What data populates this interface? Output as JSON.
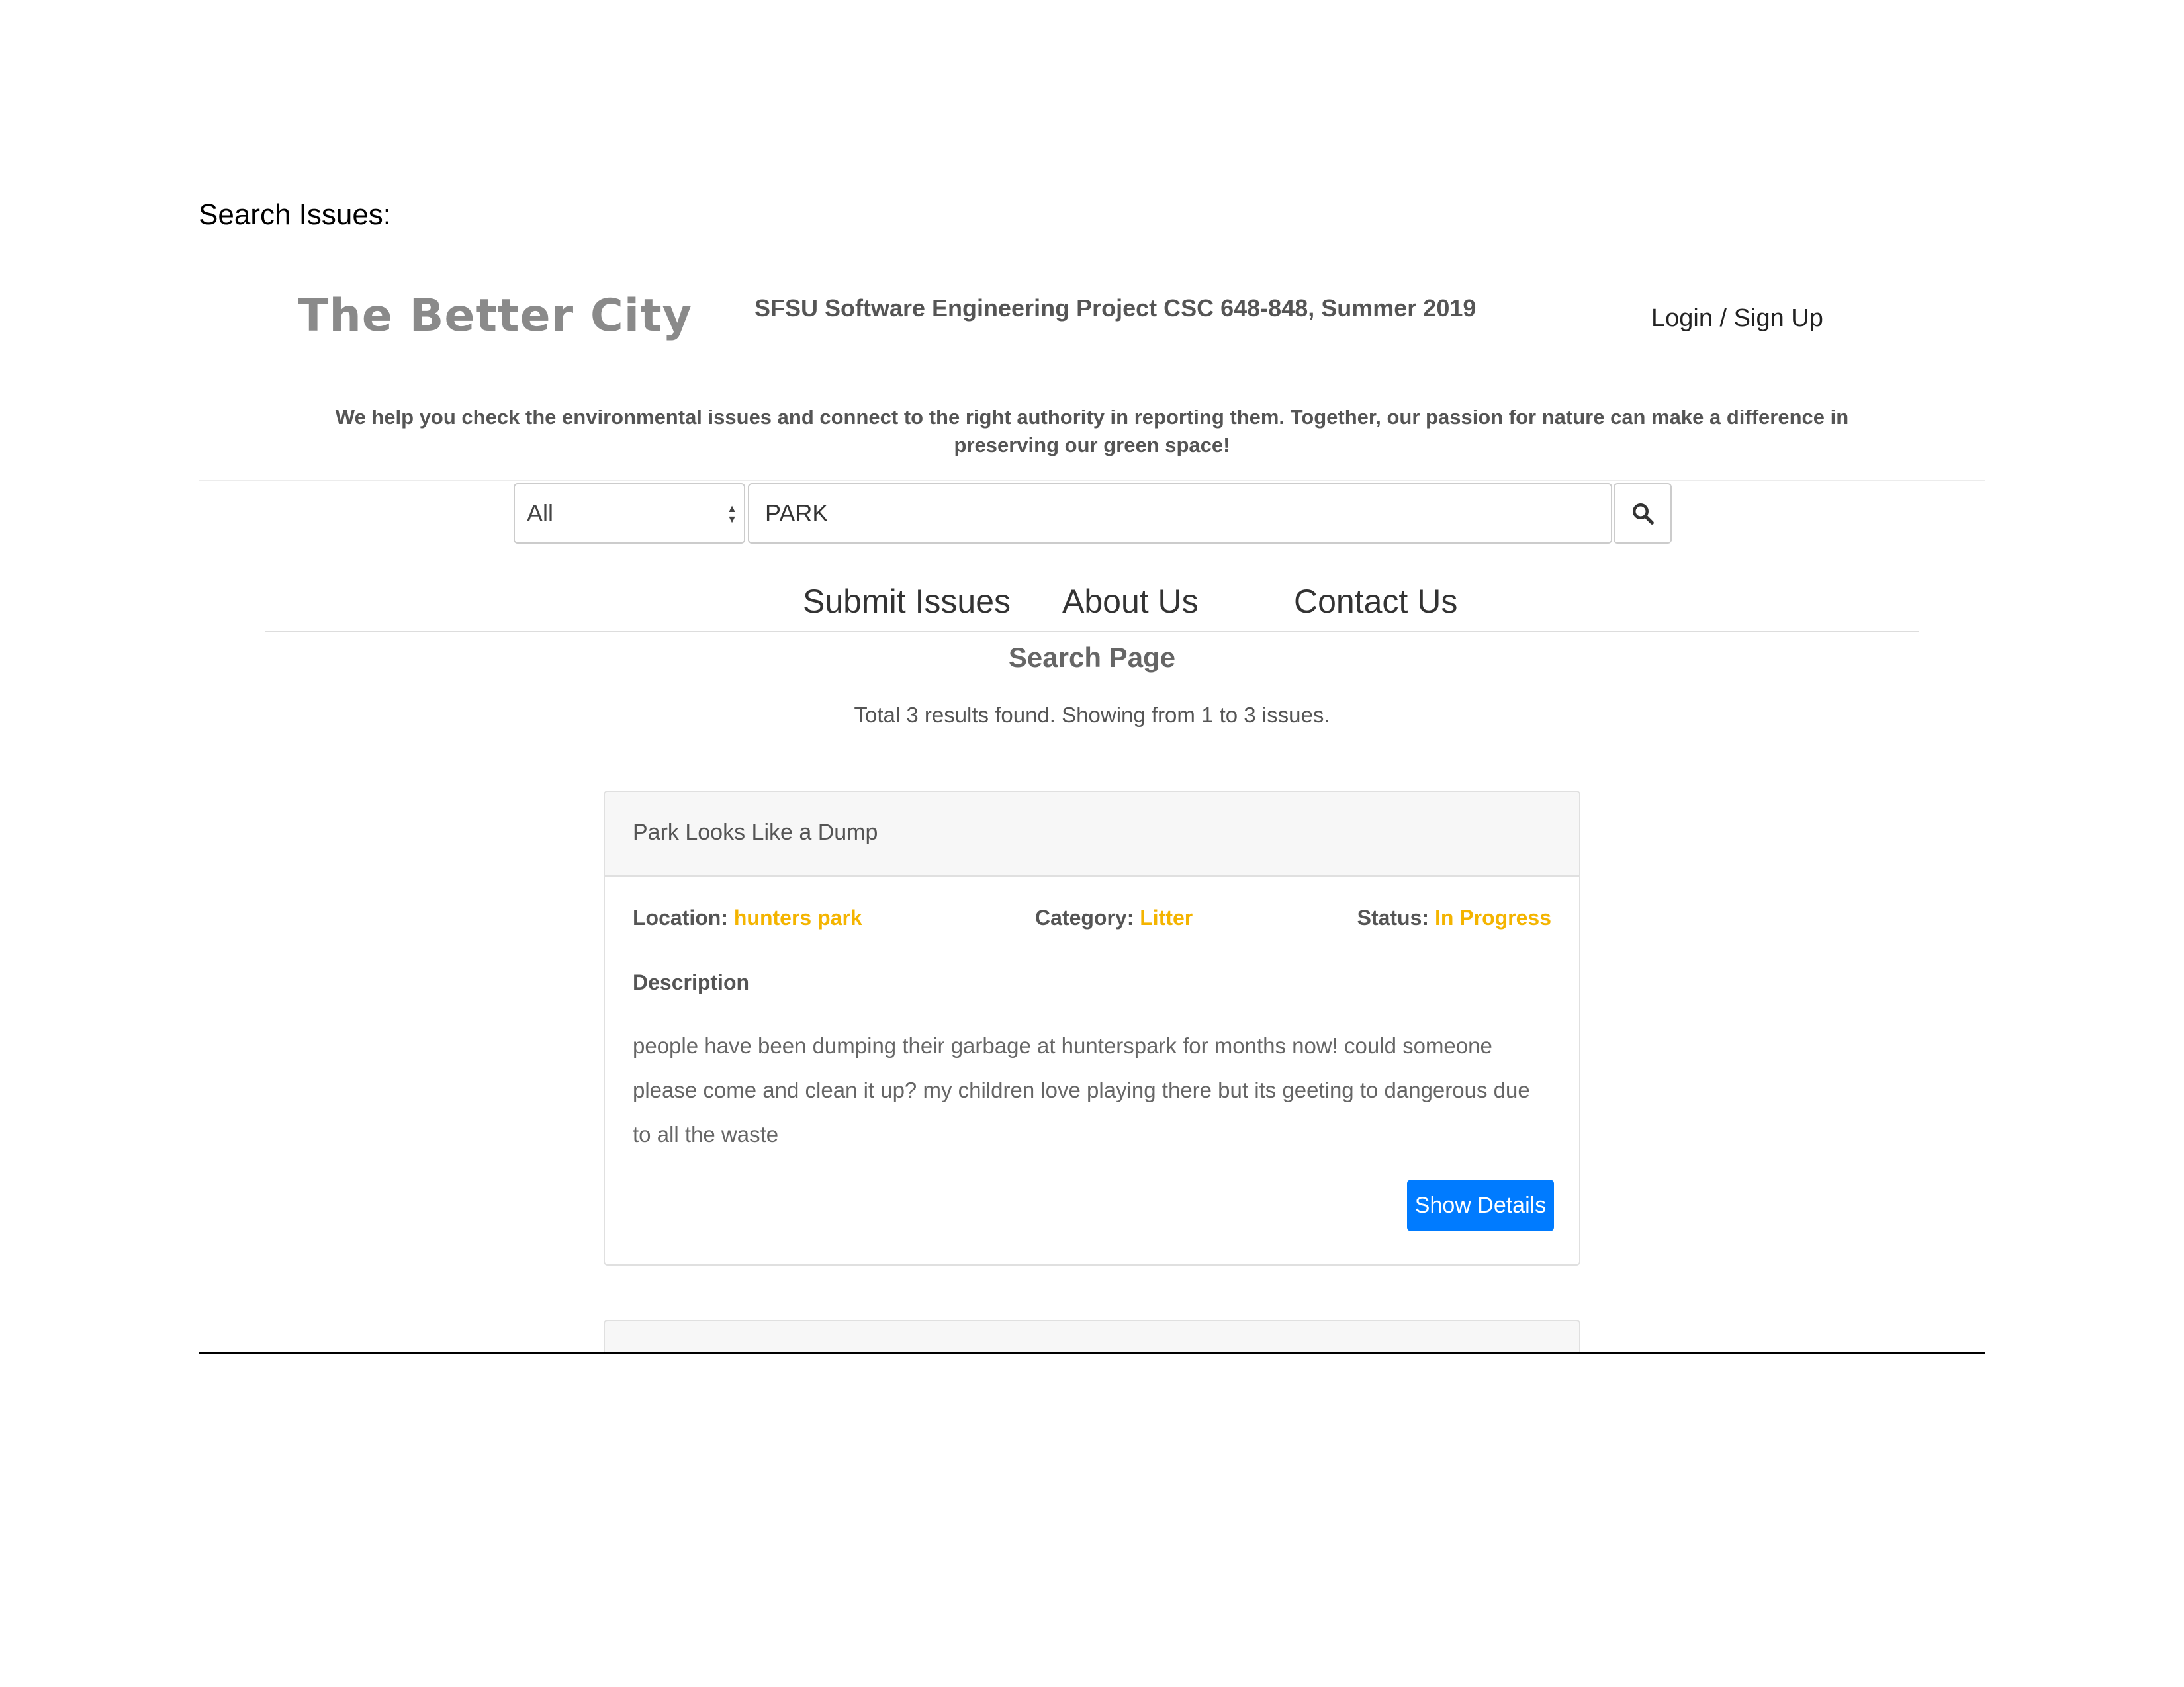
{
  "document": {
    "caption": "Search Issues:"
  },
  "header": {
    "logo": "The Better City",
    "project_title": "SFSU Software Engineering Project CSC 648-848, Summer 2019",
    "login": "Login / Sign Up",
    "tagline": "We help you check the environmental issues and connect to the right authority in reporting them. Together, our passion for nature can make a difference in preserving our green space!"
  },
  "search": {
    "category_selected": "All",
    "query": "PARK",
    "button_icon": "search-icon"
  },
  "nav": {
    "items": [
      {
        "label": "Submit Issues"
      },
      {
        "label": "About Us"
      },
      {
        "label": "Contact Us"
      }
    ]
  },
  "main": {
    "heading": "Search Page",
    "results_summary": "Total 3 results found. Showing from 1 to 3 issues."
  },
  "results": [
    {
      "title": "Park Looks Like a Dump",
      "location_label": "Location:",
      "location": "hunters park",
      "category_label": "Category:",
      "category": "Litter",
      "status_label": "Status:",
      "status": "In Progress",
      "description_label": "Description",
      "description": "people have been dumping their garbage at hunterspark for months now! could someone please come and clean it up? my children love playing there but its geeting to dangerous due to all the waste",
      "button_label": "Show Details"
    }
  ],
  "colors": {
    "accent": "#f4b400",
    "primary_button": "#007bff",
    "text": "#555555"
  }
}
